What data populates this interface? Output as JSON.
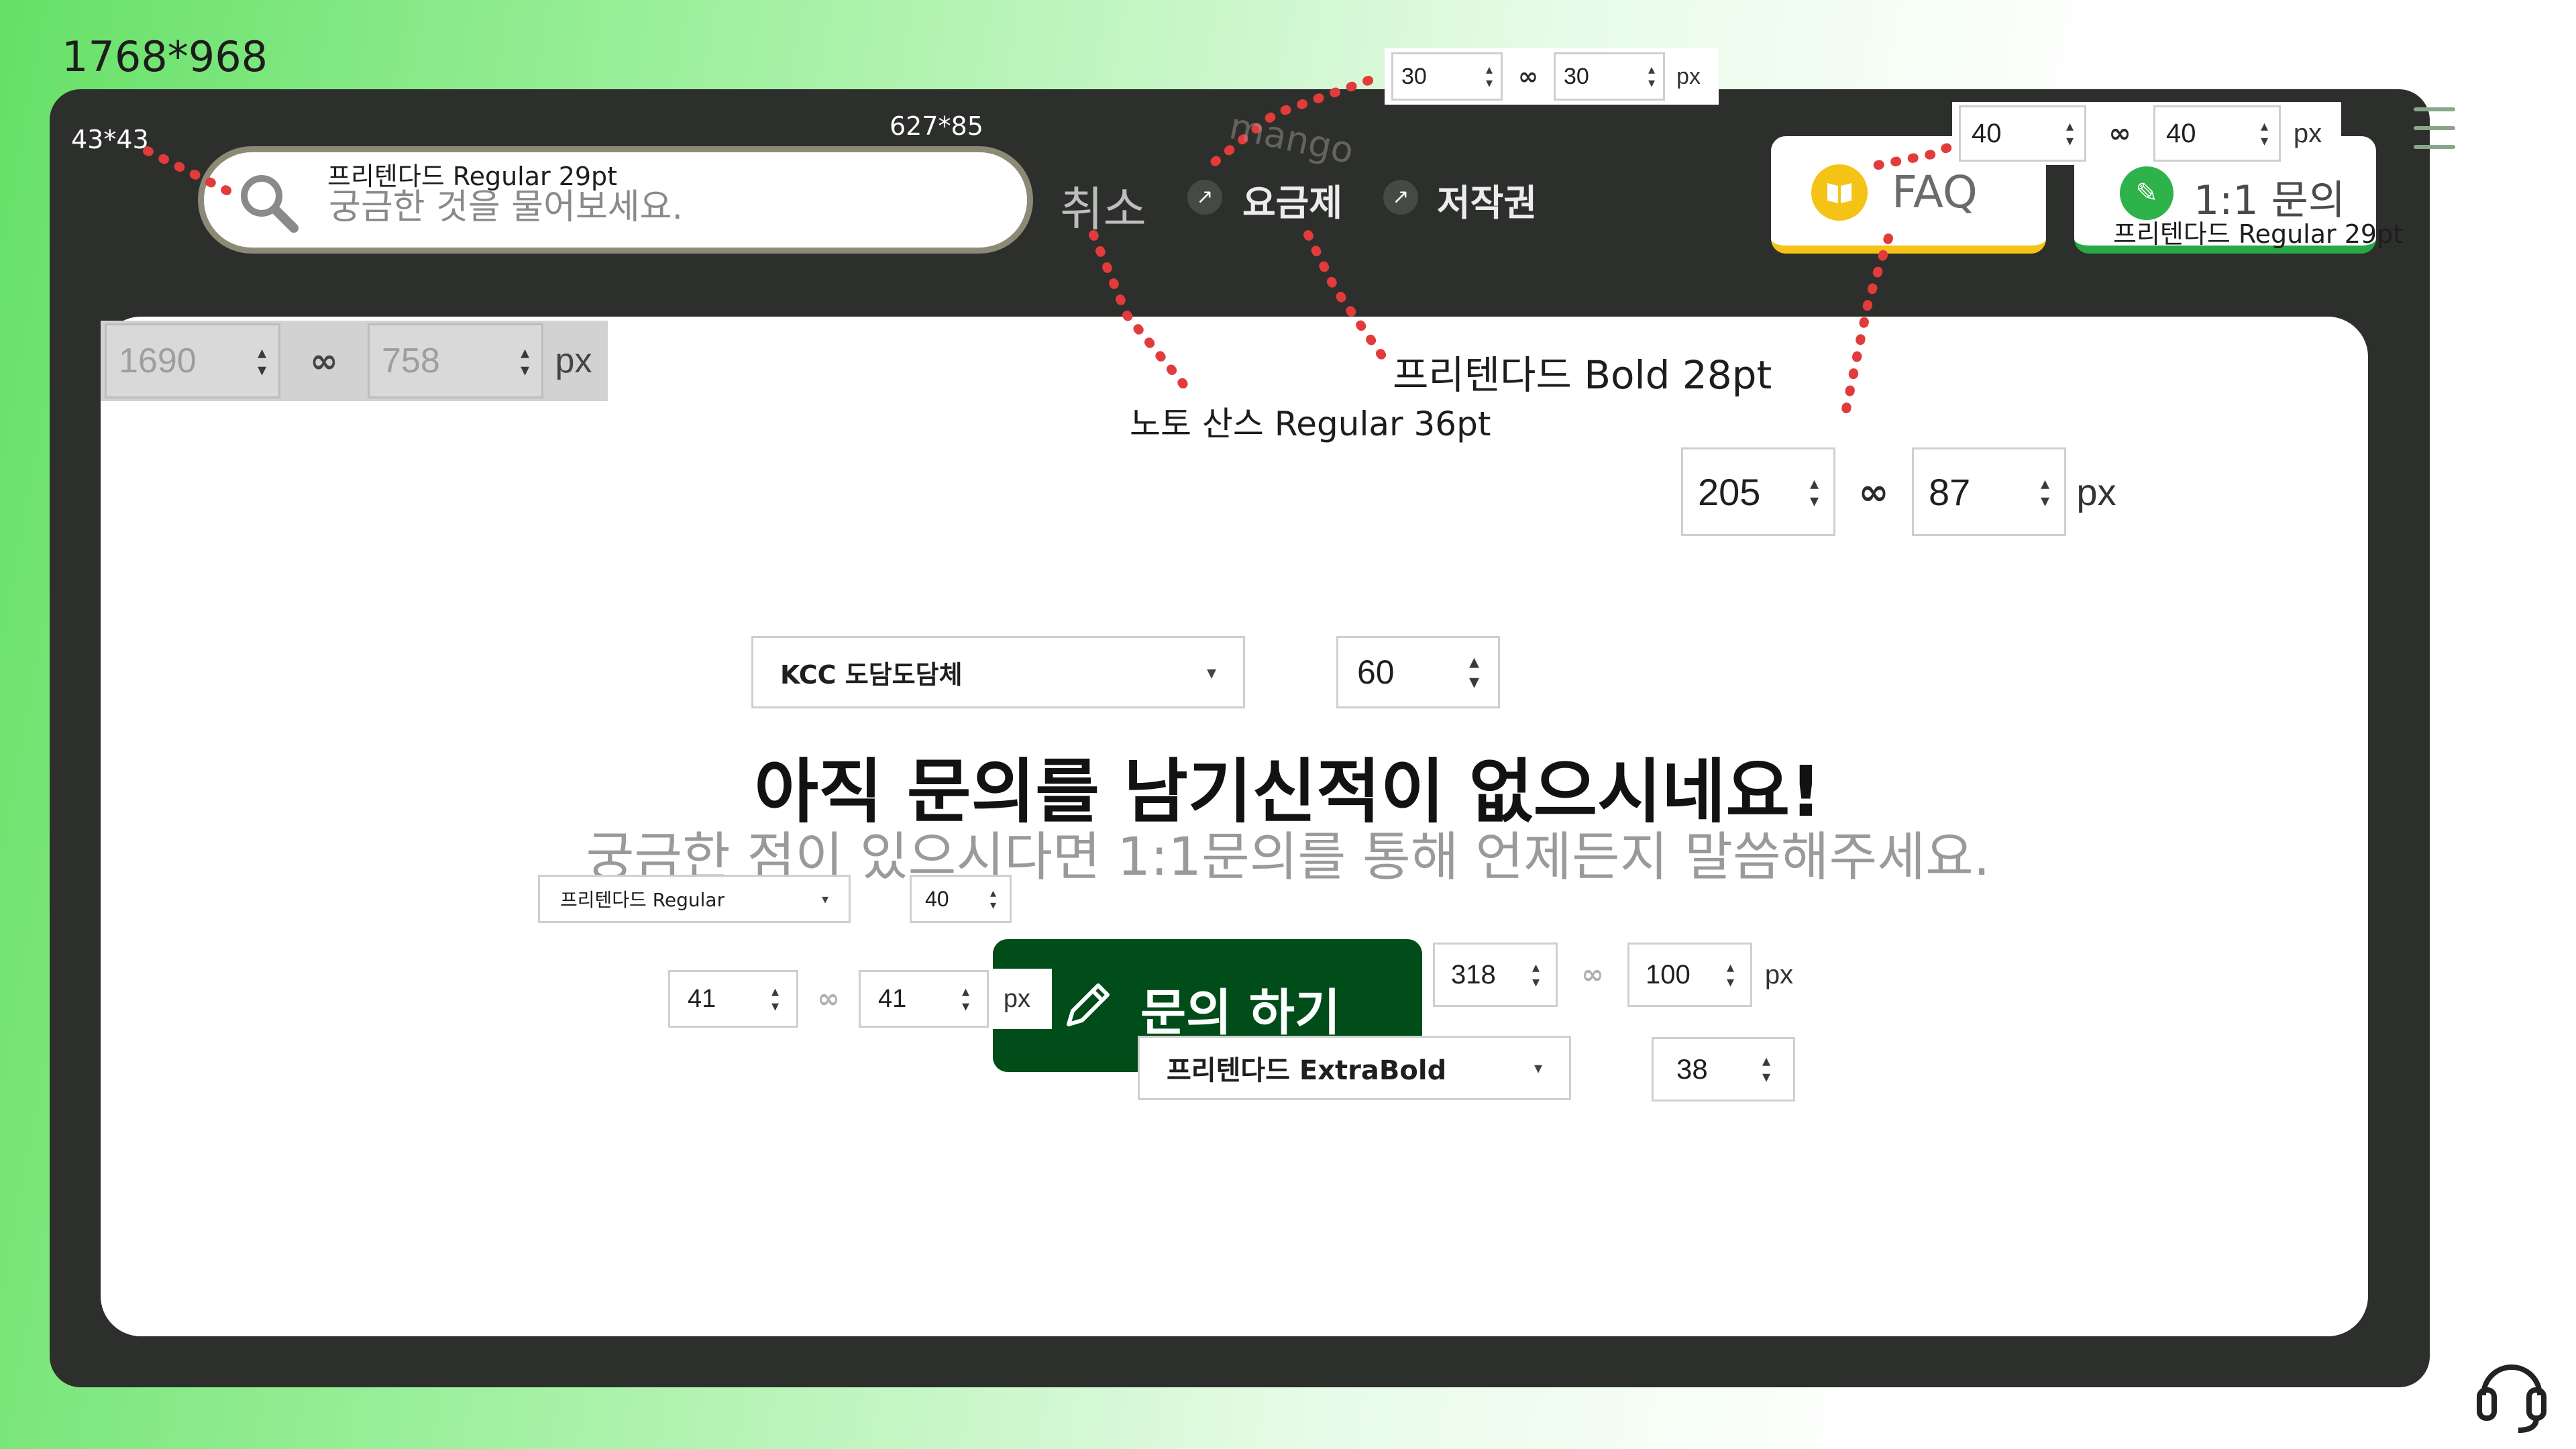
{
  "annotations": {
    "canvas_size": "1768*968",
    "icon_size": "43*43",
    "search_size": "627*85",
    "search_font": "프리텐다드 Regular 29pt",
    "nav_font": "노토 산스 Regular 36pt",
    "nav_bold_font": "프리텐다드 Bold 28pt",
    "inquiry_font": "프리텐다드 Regular 29pt"
  },
  "header": {
    "search_placeholder": "궁금한 것을 물어보세요.",
    "cancel": "취소",
    "nav": [
      {
        "label": "요금제"
      },
      {
        "label": "저작권"
      }
    ],
    "arrow_glyph": "↗",
    "faq_label": "FAQ",
    "inquiry_label": "1:1 문의"
  },
  "controls": {
    "content_size": {
      "w": "1690",
      "h": "758",
      "unit": "px"
    },
    "nav_gap": {
      "w": "30",
      "h": "30",
      "unit": "px"
    },
    "header_btn_gap": {
      "w": "40",
      "h": "40",
      "unit": "px"
    },
    "header_btn_size": {
      "w": "205",
      "h": "87",
      "unit": "px"
    },
    "title_font": {
      "family": "KCC 도담도담체",
      "size": "60"
    },
    "sub_font": {
      "family": "프리텐다드 Regular",
      "size": "40"
    },
    "icon_box": {
      "w": "41",
      "h": "41",
      "unit": "px"
    },
    "button_size": {
      "w": "318",
      "h": "100",
      "unit": "px"
    },
    "button_font": {
      "family": "프리텐다드 ExtraBold",
      "size": "38"
    }
  },
  "main": {
    "empty_title": "아직 문의를 남기신적이 없으시네요!",
    "empty_sub": "궁금한 점이 있으시다면 1:1문의를 통해 언제든지 말씀해주세요.",
    "inquire_button": "문의 하기"
  },
  "watermark": "mango",
  "colors": {
    "frame": "#2c2f2b",
    "faq_accent": "#f5c216",
    "inquiry_accent": "#28a745",
    "primary_button": "#004d1a",
    "guide_dots": "#e23b3b"
  }
}
